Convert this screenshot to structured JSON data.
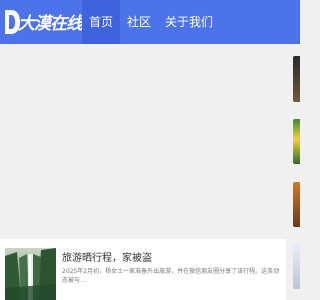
{
  "header": {
    "logo_letter": "D",
    "site_name": "大漠在线",
    "nav": [
      {
        "label": "首页",
        "active": true
      },
      {
        "label": "社区",
        "active": false
      },
      {
        "label": "关于我们",
        "active": false
      }
    ]
  },
  "article": {
    "title": "旅游晒行程，家被盗",
    "summary": "2025年2月初，杨女士一家准备外出旅游，并在微信朋友圈分享了该行程。这条动态被与…",
    "thumb_icon": "waterfall-landscape-image"
  },
  "colors": {
    "header_bg": "#4d73eb",
    "nav_active_bg": "#3e63dd",
    "page_bg": "#f0f0f0"
  }
}
